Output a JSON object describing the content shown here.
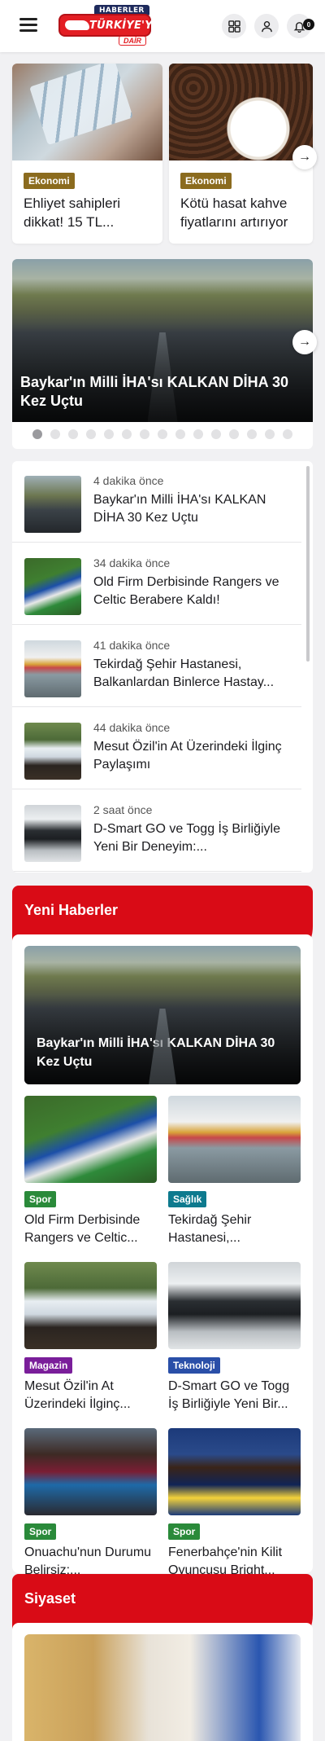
{
  "header": {
    "logo_top": "HABERLER",
    "logo_main": "TÜRKİYE'YE",
    "logo_sub": "DAİR",
    "notification_count": "0",
    "icons": [
      "menu-icon",
      "grid-icon",
      "user-icon",
      "bell-icon"
    ]
  },
  "top_cards": [
    {
      "category": "Ekonomi",
      "title": "Ehliyet sahipleri dikkat! 15 TL..."
    },
    {
      "category": "Ekonomi",
      "title": "Kötü hasat kahve fiyatlarını artırıyor"
    }
  ],
  "slider": {
    "title": "Baykar'ın Milli İHA'sı KALKAN DİHA 30 Kez Uçtu",
    "dot_count": 15,
    "active_dot": 0
  },
  "recent": [
    {
      "time": "4 dakika önce",
      "title": "Baykar'ın Milli İHA'sı KALKAN DİHA 30 Kez Uçtu"
    },
    {
      "time": "34 dakika önce",
      "title": "Old Firm Derbisinde Rangers ve Celtic Berabere Kaldı!"
    },
    {
      "time": "41 dakika önce",
      "title": "Tekirdağ Şehir Hastanesi, Balkanlardan Binlerce Hastay..."
    },
    {
      "time": "44 dakika önce",
      "title": "Mesut Özil'in At Üzerindeki İlginç Paylaşımı"
    },
    {
      "time": "2 saat önce",
      "title": "D-Smart GO ve Togg İş Birliğiyle Yeni Bir Deneyim:..."
    }
  ],
  "yeni_haberler": {
    "heading": "Yeni Haberler",
    "feature_title": "Baykar'ın Milli İHA'sı KALKAN DİHA 30 Kez Uçtu",
    "cards": [
      {
        "category": "Spor",
        "title": "Old Firm Derbisinde Rangers ve Celtic...",
        "color": "#2a8a3a"
      },
      {
        "category": "Sağlık",
        "title": "Tekirdağ Şehir Hastanesi,...",
        "color": "#0e7a8e"
      },
      {
        "category": "Magazin",
        "title": "Mesut Özil'in At Üzerindeki İlginç...",
        "color": "#7a1e9a"
      },
      {
        "category": "Teknoloji",
        "title": "D-Smart GO ve Togg İş Birliğiyle Yeni Bir...",
        "color": "#2a4fa8"
      },
      {
        "category": "Spor",
        "title": "Onuachu'nun Durumu Belirsiz:...",
        "color": "#2a8a3a"
      },
      {
        "category": "Spor",
        "title": "Fenerbahçe'nin Kilit Oyuncusu Bright...",
        "color": "#2a8a3a"
      }
    ]
  },
  "siyaset": {
    "heading": "Siyaset"
  },
  "colors": {
    "brand_red": "#d90b16",
    "economy": "#8b6b1e"
  }
}
